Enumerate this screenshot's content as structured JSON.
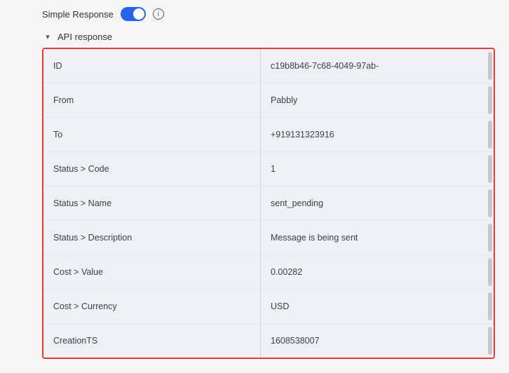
{
  "topBar": {
    "simpleResponseLabel": "Simple Response",
    "infoSymbol": "i"
  },
  "apiResponse": {
    "headerLabel": "API response",
    "chevron": "▾"
  },
  "fields": [
    {
      "label": "ID",
      "value": "c19b8b46-7c68-4049-97ab-"
    },
    {
      "label": "From",
      "value": "Pabbly"
    },
    {
      "label": "To",
      "value": "+919131323916"
    },
    {
      "label": "Status > Code",
      "value": "1"
    },
    {
      "label": "Status > Name",
      "value": "sent_pending"
    },
    {
      "label": "Status > Description",
      "value": "Message is being sent"
    },
    {
      "label": "Cost > Value",
      "value": "0.00282"
    },
    {
      "label": "Cost > Currency",
      "value": "USD"
    },
    {
      "label": "CreationTS",
      "value": "1608538007"
    }
  ]
}
